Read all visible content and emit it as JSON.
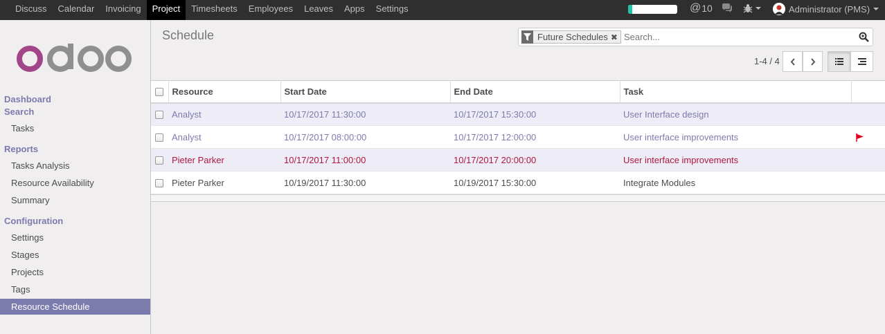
{
  "topbar": {
    "menu": [
      "Discuss",
      "Calendar",
      "Invoicing",
      "Project",
      "Timesheets",
      "Employees",
      "Leaves",
      "Apps",
      "Settings"
    ],
    "active_menu": "Project",
    "progress_fraction": 0.08,
    "mentions_count": "10",
    "user_label": "Administrator (PMS)"
  },
  "sidebar": {
    "sections": [
      {
        "heading": "Dashboard",
        "items": []
      },
      {
        "heading": "Search",
        "items": [
          "Tasks"
        ]
      },
      {
        "heading": "Reports",
        "items": [
          "Tasks Analysis",
          "Resource Availability",
          "Summary"
        ]
      },
      {
        "heading": "Configuration",
        "items": [
          "Settings",
          "Stages",
          "Projects",
          "Tags",
          "Resource Schedule"
        ]
      }
    ],
    "active_item": "Resource Schedule"
  },
  "control_panel": {
    "title": "Schedule",
    "facet_label": "Future Schedules",
    "search_placeholder": "Search...",
    "pager": "1-4 / 4"
  },
  "table": {
    "columns": [
      "Resource",
      "Start Date",
      "End Date",
      "Task"
    ],
    "rows": [
      {
        "resource": "Analyst",
        "start": "10/17/2017 11:30:00",
        "end": "10/17/2017 15:30:00",
        "task": "User Interface design",
        "style": "purple",
        "flag": false
      },
      {
        "resource": "Analyst",
        "start": "10/17/2017 08:00:00",
        "end": "10/17/2017 12:00:00",
        "task": "User interface improvements",
        "style": "blue",
        "flag": true
      },
      {
        "resource": "Pieter Parker",
        "start": "10/17/2017 11:00:00",
        "end": "10/17/2017 20:00:00",
        "task": "User interface improvements",
        "style": "red",
        "flag": false
      },
      {
        "resource": "Pieter Parker",
        "start": "10/19/2017 11:30:00",
        "end": "10/19/2017 15:30:00",
        "task": "Integrate Modules",
        "style": "black",
        "flag": false
      }
    ]
  },
  "colors": {
    "accent": "#7c7bad",
    "overdue": "#b0163d",
    "flag": "#e0001b"
  }
}
